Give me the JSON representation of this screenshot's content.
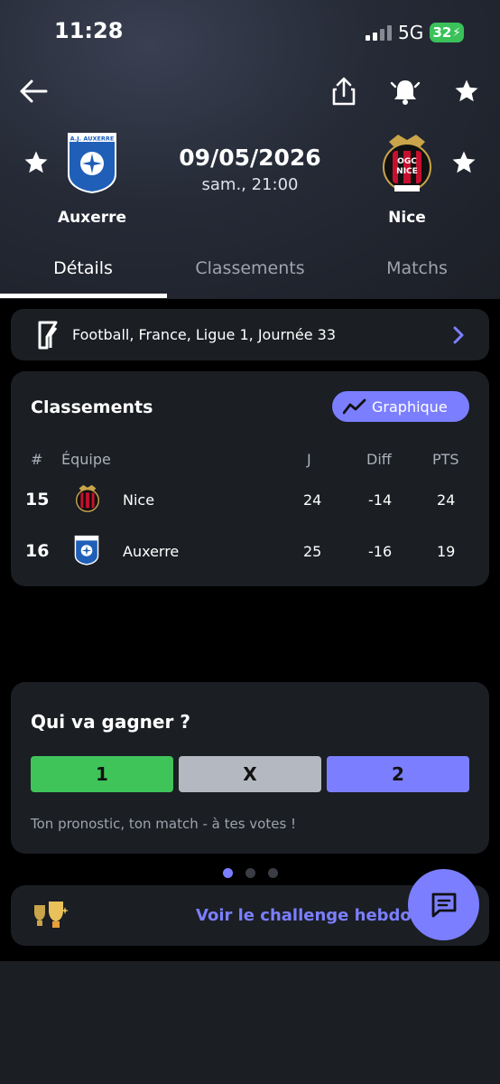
{
  "status": {
    "time": "11:28",
    "network": "5G",
    "battery": "32"
  },
  "match": {
    "home": {
      "name": "Auxerre",
      "logo_text": "A.J. AUXERRE"
    },
    "away": {
      "name": "Nice",
      "logo_text": "OGC NICE"
    },
    "date": "09/05/2026",
    "time": "sam., 21:00"
  },
  "tabs": [
    "Détails",
    "Classements",
    "Matchs"
  ],
  "competition": {
    "text": "Football, France, Ligue 1, Journée 33"
  },
  "standings": {
    "title": "Classements",
    "graph_button": "Graphique",
    "headers": {
      "rank": "#",
      "team": "Équipe",
      "played": "J",
      "diff": "Diff",
      "pts": "PTS"
    },
    "rows": [
      {
        "rank": "15",
        "team": "Nice",
        "played": "24",
        "diff": "-14",
        "pts": "24"
      },
      {
        "rank": "16",
        "team": "Auxerre",
        "played": "25",
        "diff": "-16",
        "pts": "19"
      }
    ]
  },
  "poll": {
    "title": "Qui va gagner ?",
    "options": [
      "1",
      "X",
      "2"
    ],
    "option_colors": [
      "#3fc45a",
      "#b4b8c0",
      "#7b7fff"
    ],
    "caption": "Ton pronostic, ton match - à tes votes !"
  },
  "challenge": {
    "text": "Voir le challenge hebdoma"
  },
  "colors": {
    "accent": "#7b7fff",
    "card": "#1b1e23",
    "green": "#3fc45a"
  }
}
